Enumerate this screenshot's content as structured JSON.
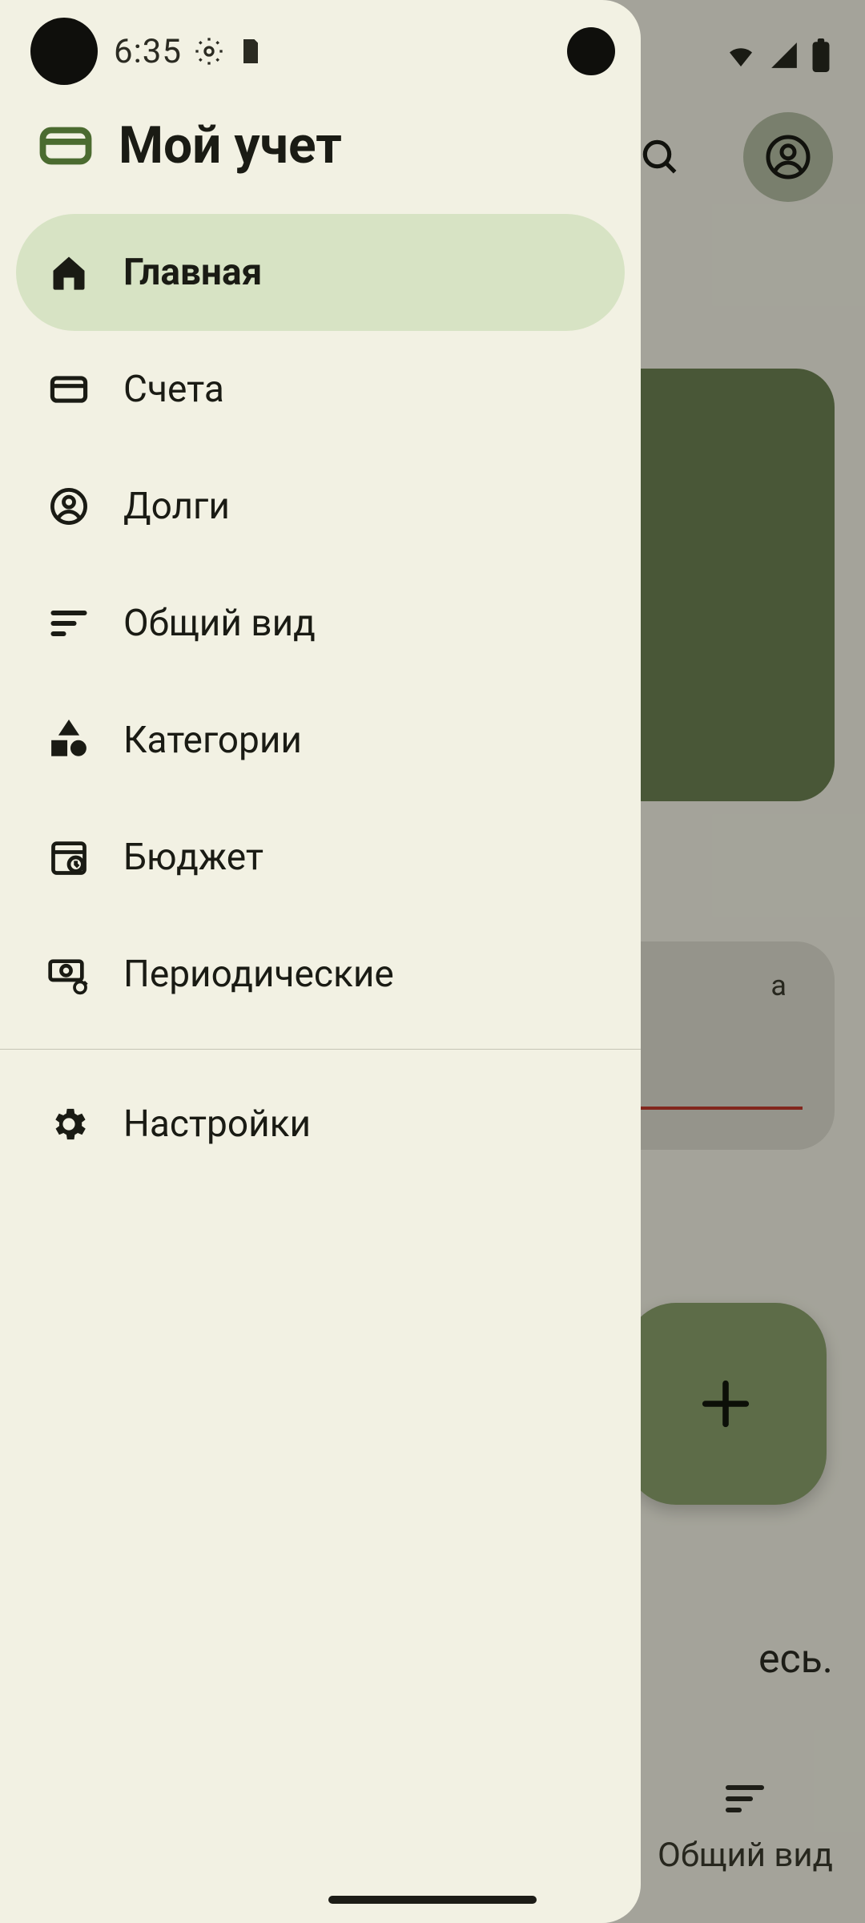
{
  "status": {
    "time": "6:35"
  },
  "drawer": {
    "title": "Мой учет",
    "items": [
      {
        "label": "Главная",
        "icon": "home-icon",
        "selected": true
      },
      {
        "label": "Счета",
        "icon": "card-icon",
        "selected": false
      },
      {
        "label": "Долги",
        "icon": "person-icon",
        "selected": false
      },
      {
        "label": "Общий вид",
        "icon": "sort-icon",
        "selected": false
      },
      {
        "label": "Категории",
        "icon": "shapes-icon",
        "selected": false
      },
      {
        "label": "Бюджет",
        "icon": "calendar-icon",
        "selected": false
      },
      {
        "label": "Периодические",
        "icon": "recurring-icon",
        "selected": false
      }
    ],
    "footer_items": [
      {
        "label": "Настройки",
        "icon": "gear-icon",
        "selected": false
      }
    ]
  },
  "background": {
    "partial_card_label": "а",
    "partial_text": "есь.",
    "bottom_bar_label": "Общий вид"
  },
  "colors": {
    "surface": "#f2f1e3",
    "primary": "#6c8051",
    "selected_bg": "#d7e3c4",
    "fab": "#8aa06a"
  }
}
